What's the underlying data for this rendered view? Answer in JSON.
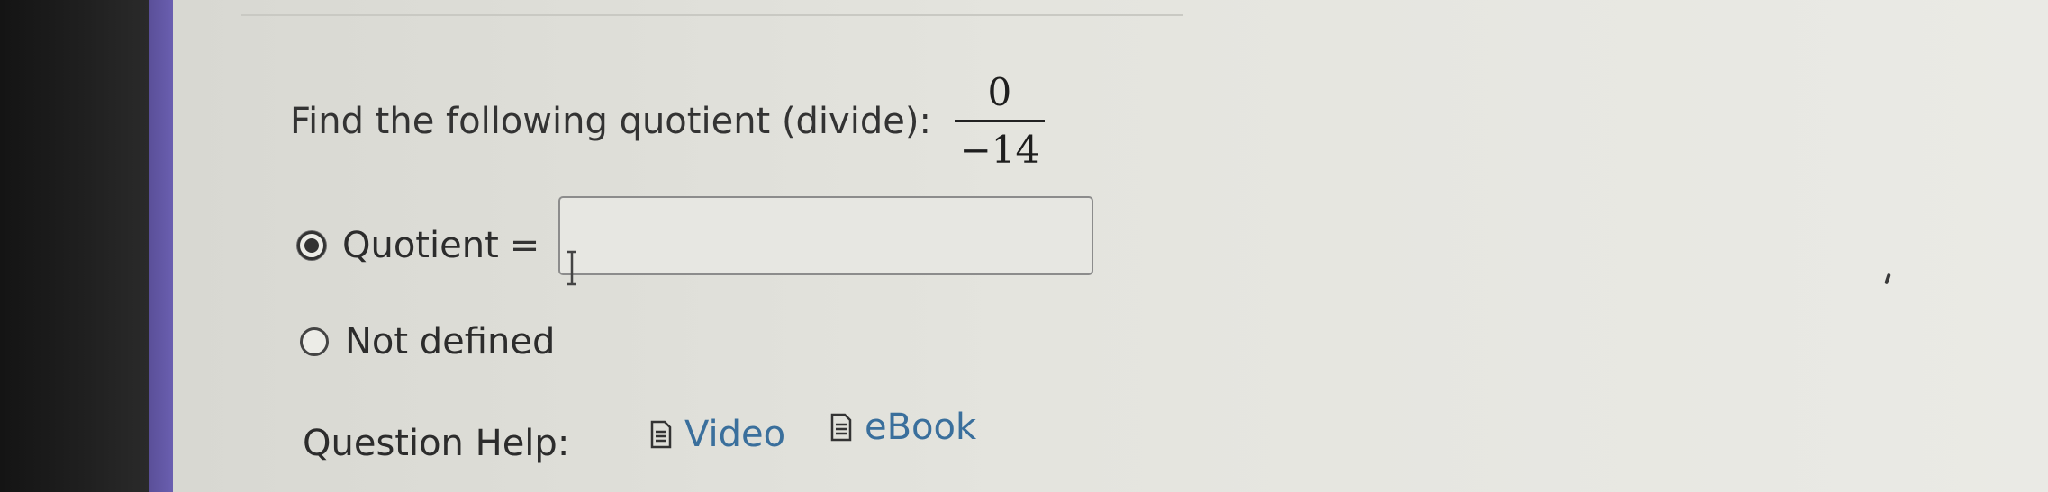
{
  "question": {
    "prompt": "Find the following quotient (divide):",
    "numerator": "0",
    "denominator": "−14"
  },
  "options": {
    "quotient": {
      "label": "Quotient",
      "equals": "=",
      "selected": true,
      "input_value": ""
    },
    "not_defined": {
      "label": "Not defined",
      "selected": false
    }
  },
  "help": {
    "label": "Question Help:",
    "video": "Video",
    "ebook": "eBook",
    "link_color": "#3a6f9c",
    "video_icon": "document-icon",
    "ebook_icon": "document-icon"
  },
  "colors": {
    "accent_bar": "#6a5fb0",
    "panel_background": "#e4e4de"
  }
}
